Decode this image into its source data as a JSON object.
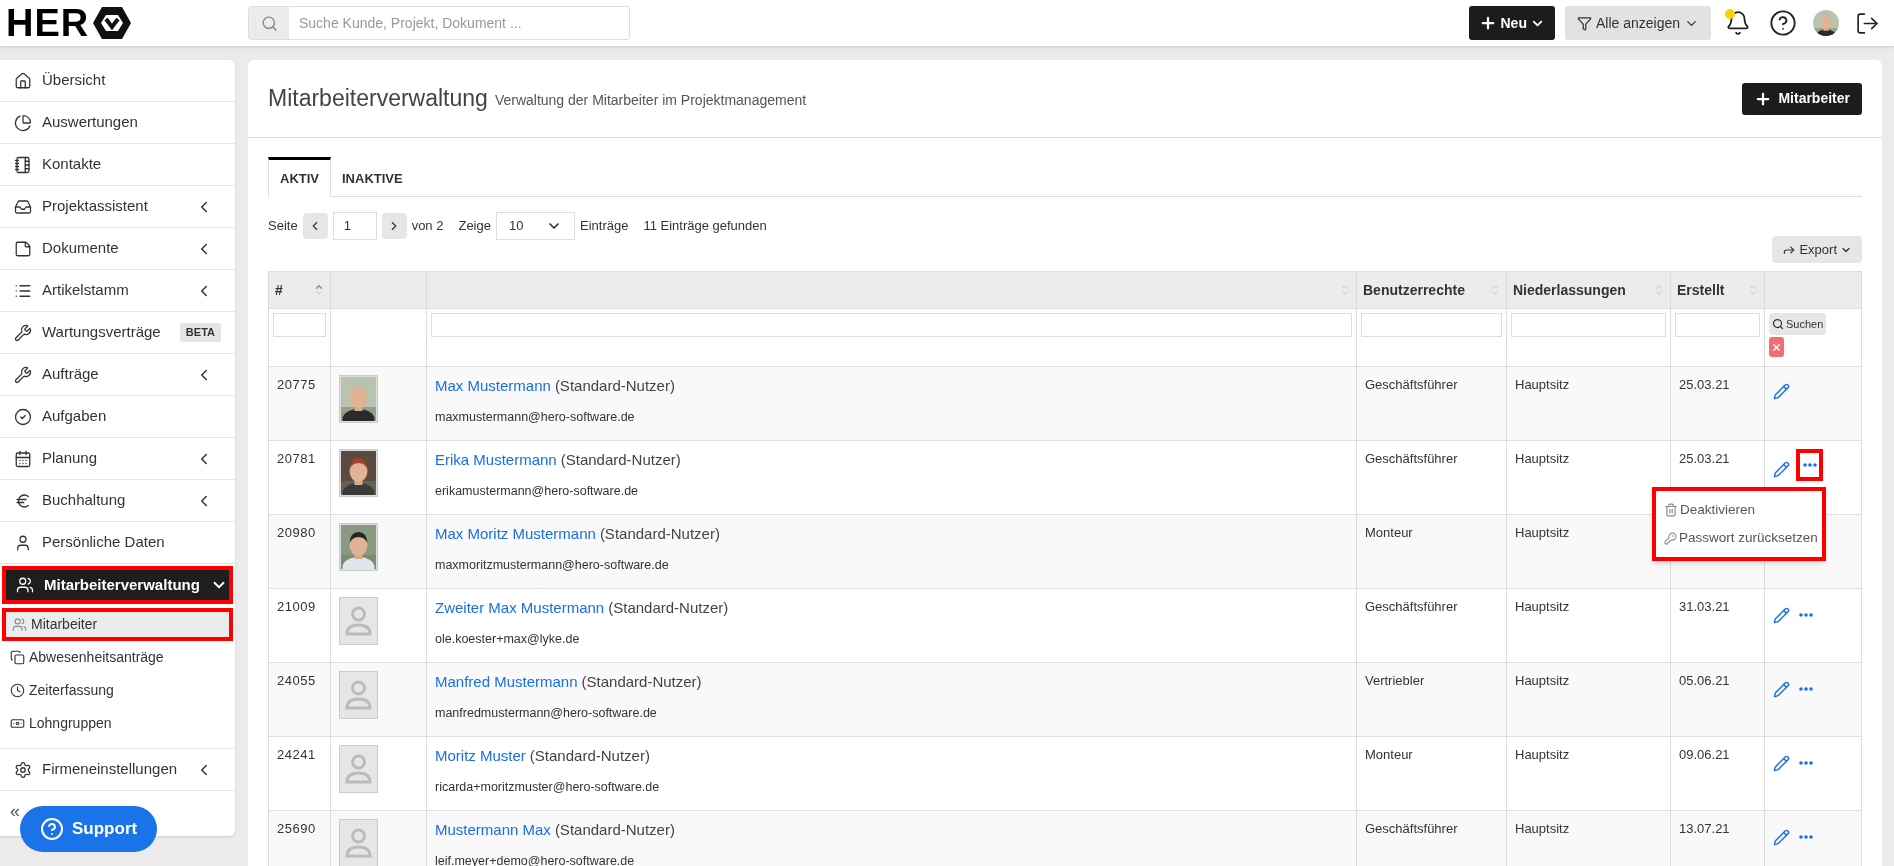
{
  "topbar": {
    "logo": "HER",
    "search_placeholder": "Suche Kunde, Projekt, Dokument ...",
    "new_button": "Neu",
    "filter_button": "Alle anzeigen",
    "notification_dot": true
  },
  "sidebar": {
    "items": [
      {
        "label": "Übersicht",
        "selected": false
      },
      {
        "label": "Auswertungen",
        "selected": false
      },
      {
        "label": "Kontakte",
        "selected": false
      },
      {
        "label": "Projektassistent",
        "selected": false,
        "expanded": false
      },
      {
        "label": "Dokumente",
        "selected": false,
        "expanded": false
      },
      {
        "label": "Artikelstamm",
        "selected": false,
        "expanded": false
      },
      {
        "label": "Wartungsverträge",
        "selected": false,
        "badge": "BETA"
      },
      {
        "label": "Aufträge",
        "selected": false,
        "expanded": false
      },
      {
        "label": "Aufgaben",
        "selected": false
      },
      {
        "label": "Planung",
        "selected": false,
        "expanded": false
      },
      {
        "label": "Buchhaltung",
        "selected": false,
        "expanded": false
      },
      {
        "label": "Persönliche Daten",
        "selected": false
      },
      {
        "label": "Mitarbeiterverwaltung",
        "selected": true,
        "expanded": true,
        "highlighted": true,
        "children": [
          {
            "label": "Mitarbeiter",
            "selected": true,
            "highlighted": true
          },
          {
            "label": "Abwesenheitsanträge",
            "selected": false,
            "highlighted": false
          },
          {
            "label": "Zeiterfassung",
            "selected": false,
            "highlighted": false
          },
          {
            "label": "Lohngruppen",
            "selected": false,
            "highlighted": false
          }
        ]
      },
      {
        "label": "Firmeneinstellungen",
        "selected": false,
        "expanded": false
      }
    ],
    "collapse": "«",
    "support": "Support"
  },
  "main": {
    "title": "Mitarbeiterverwaltung",
    "subtitle": "Verwaltung der Mitarbeiter im Projektmanagement",
    "add_button": "Mitarbeiter",
    "tabs": [
      {
        "label": "AKTIV",
        "selected": true
      },
      {
        "label": "INAKTIVE",
        "selected": false
      }
    ],
    "pagination": {
      "page_label": "Seite",
      "page": "1",
      "of": "von 2",
      "show_label": "Zeige",
      "page_size": "10",
      "entries_label": "Einträge",
      "found": "11 Einträge gefunden"
    },
    "export": "Export",
    "table": {
      "columns": [
        {
          "label": "#",
          "sortable": true,
          "sorted": true,
          "filter": true
        },
        {
          "sortable": false,
          "filter": false
        },
        {
          "sortable": true,
          "sorted": false,
          "filter": true
        },
        {
          "label": "Benutzerrechte",
          "sortable": true,
          "sorted": false,
          "filter": true
        },
        {
          "label": "Niederlassungen",
          "sortable": true,
          "sorted": false,
          "filter": true
        },
        {
          "label": "Erstellt",
          "sortable": true,
          "sorted": false,
          "filter": true
        },
        {
          "sortable": false,
          "filter": false
        }
      ],
      "search_button": "Suchen",
      "rows": [
        {
          "id": "20775",
          "has_photo": true,
          "name": "Max Mustermann",
          "role": "(Standard-Nutzer)",
          "email": "maxmustermann@hero-software.de",
          "rights": "Geschäftsführer",
          "branch": "Hauptsitz",
          "created": "25.03.21",
          "actions": [
            {
              "kind": "edit"
            }
          ]
        },
        {
          "id": "20781",
          "has_photo": true,
          "name": "Erika Mustermann",
          "role": "(Standard-Nutzer)",
          "email": "erikamustermann@hero-software.de",
          "rights": "Geschäftsführer",
          "branch": "Hauptsitz",
          "created": "25.03.21",
          "actions": [
            {
              "kind": "edit"
            },
            {
              "kind": "more",
              "highlighted": true
            }
          ],
          "menu": {
            "highlighted": true,
            "items": [
              {
                "kind": "delete",
                "label": "Deaktivieren"
              },
              {
                "kind": "key",
                "label": "Passwort zurücksetzen"
              }
            ]
          }
        },
        {
          "id": "20980",
          "has_photo": true,
          "name": "Max Moritz Mustermann",
          "role": "(Standard-Nutzer)",
          "email": "maxmoritzmustermann@hero-software.de",
          "rights": "Monteur",
          "branch": "Hauptsitz",
          "actions": []
        },
        {
          "id": "21009",
          "has_photo": false,
          "name": "Zweiter Max Mustermann",
          "role": "(Standard-Nutzer)",
          "email": "ole.koester+max@lyke.de",
          "rights": "Geschäftsführer",
          "branch": "Hauptsitz",
          "created": "31.03.21",
          "actions": [
            {
              "kind": "edit"
            },
            {
              "kind": "more",
              "highlighted": false
            }
          ]
        },
        {
          "id": "24055",
          "has_photo": false,
          "name": "Manfred Mustermann",
          "role": "(Standard-Nutzer)",
          "email": "manfredmustermann@hero-software.de",
          "rights": "Vertriebler",
          "branch": "Hauptsitz",
          "created": "05.06.21",
          "actions": [
            {
              "kind": "edit"
            },
            {
              "kind": "more",
              "highlighted": false
            }
          ]
        },
        {
          "id": "24241",
          "has_photo": false,
          "name": "Moritz Muster",
          "role": "(Standard-Nutzer)",
          "email": "ricarda+moritzmuster@hero-software.de",
          "rights": "Monteur",
          "branch": "Hauptsitz",
          "created": "09.06.21",
          "actions": [
            {
              "kind": "edit"
            },
            {
              "kind": "more",
              "highlighted": false
            }
          ]
        },
        {
          "id": "25690",
          "has_photo": false,
          "name": "Mustermann Max",
          "role": "(Standard-Nutzer)",
          "email": "leif.meyer+demo@hero-software.de",
          "rights": "Geschäftsführer",
          "branch": "Hauptsitz",
          "created": "13.07.21",
          "actions": [
            {
              "kind": "edit"
            },
            {
              "kind": "more",
              "highlighted": false
            }
          ]
        }
      ]
    }
  }
}
